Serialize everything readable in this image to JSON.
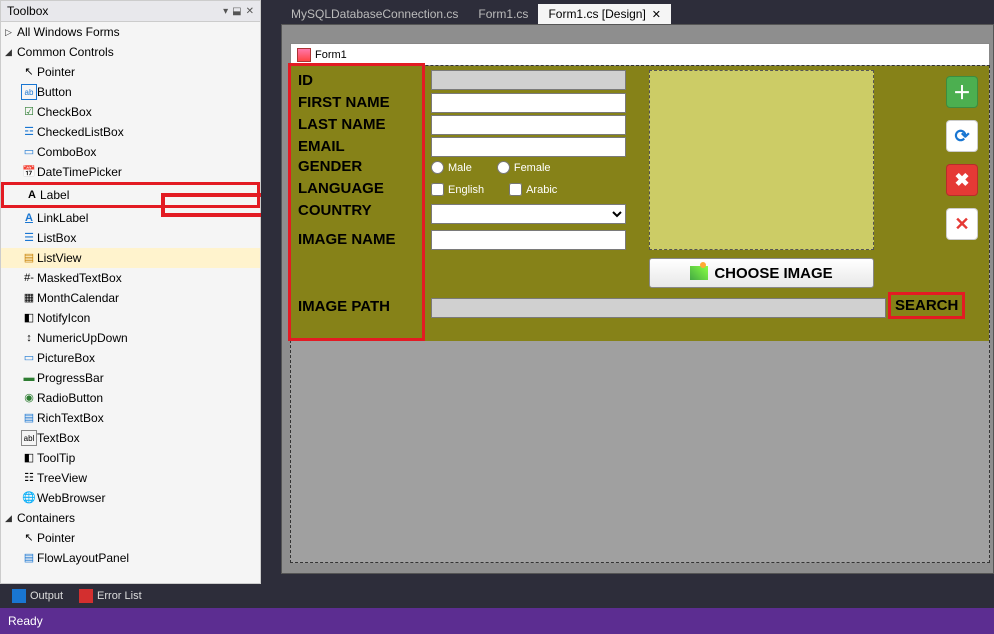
{
  "toolbox": {
    "title": "Toolbox",
    "groups": {
      "all_forms": "All Windows Forms",
      "common": "Common Controls",
      "containers": "Containers"
    },
    "items": [
      {
        "label": "Pointer",
        "icon": "↖"
      },
      {
        "label": "Button",
        "icon": "ab"
      },
      {
        "label": "CheckBox",
        "icon": "☑"
      },
      {
        "label": "CheckedListBox",
        "icon": "☲"
      },
      {
        "label": "ComboBox",
        "icon": "▭"
      },
      {
        "label": "DateTimePicker",
        "icon": "📅"
      },
      {
        "label": "Label",
        "icon": "A"
      },
      {
        "label": "LinkLabel",
        "icon": "A"
      },
      {
        "label": "ListBox",
        "icon": "☰"
      },
      {
        "label": "ListView",
        "icon": "▤"
      },
      {
        "label": "MaskedTextBox",
        "icon": "#-"
      },
      {
        "label": "MonthCalendar",
        "icon": "▦"
      },
      {
        "label": "NotifyIcon",
        "icon": "◧"
      },
      {
        "label": "NumericUpDown",
        "icon": "↕"
      },
      {
        "label": "PictureBox",
        "icon": "▭"
      },
      {
        "label": "ProgressBar",
        "icon": "▬"
      },
      {
        "label": "RadioButton",
        "icon": "◉"
      },
      {
        "label": "RichTextBox",
        "icon": "▤"
      },
      {
        "label": "TextBox",
        "icon": "abl"
      },
      {
        "label": "ToolTip",
        "icon": "◧"
      },
      {
        "label": "TreeView",
        "icon": "☷"
      },
      {
        "label": "WebBrowser",
        "icon": "🌐"
      }
    ],
    "container_items": [
      {
        "label": "Pointer",
        "icon": "↖"
      },
      {
        "label": "FlowLayoutPanel",
        "icon": "▤"
      }
    ]
  },
  "tabs": [
    {
      "label": "MySQLDatabaseConnection.cs",
      "active": false
    },
    {
      "label": "Form1.cs",
      "active": false
    },
    {
      "label": "Form1.cs [Design]",
      "active": true
    }
  ],
  "form": {
    "title": "Form1",
    "labels": {
      "id": "ID",
      "first": "FIRST NAME",
      "last": "LAST NAME",
      "email": "EMAIL",
      "gender": "GENDER",
      "language": "LANGUAGE",
      "country": "COUNTRY",
      "image_name": "IMAGE NAME",
      "image_path": "IMAGE PATH"
    },
    "gender_options": {
      "male": "Male",
      "female": "Female"
    },
    "language_options": {
      "english": "English",
      "arabic": "Arabic"
    },
    "choose_image": "CHOOSE IMAGE",
    "search": "SEARCH"
  },
  "bottom": {
    "output": "Output",
    "error": "Error List"
  },
  "status": "Ready"
}
